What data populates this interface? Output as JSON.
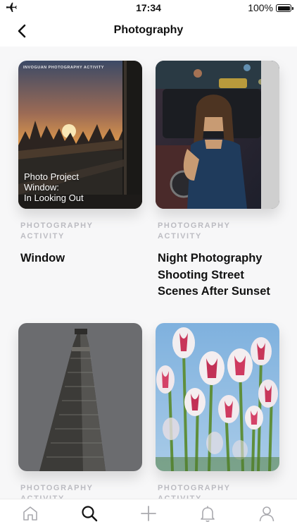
{
  "status_bar": {
    "time": "17:34",
    "battery": "100%"
  },
  "header": {
    "title": "Photography"
  },
  "cards": [
    {
      "category": "PHOTOGRAPHY ACTIVITY",
      "title": "Window",
      "image_brand": "INVOGUAN PHOTOGRAPHY ACTIVITY",
      "image_caption_1": "Photo Project",
      "image_caption_2": "Window:",
      "image_caption_3": "In Looking Out"
    },
    {
      "category": "PHOTOGRAPHY ACTIVITY",
      "title_1": "Night Photography",
      "title_2": "Shooting Street",
      "title_3": "Scenes After Sunset"
    },
    {
      "category": "PHOTOGRAPHY ACTIVITY"
    },
    {
      "category": "PHOTOGRAPHY ACTIVITY"
    }
  ],
  "tabs": [
    "home-icon",
    "search-icon",
    "plus-icon",
    "bell-icon",
    "profile-icon"
  ],
  "active_tab": "search-icon"
}
